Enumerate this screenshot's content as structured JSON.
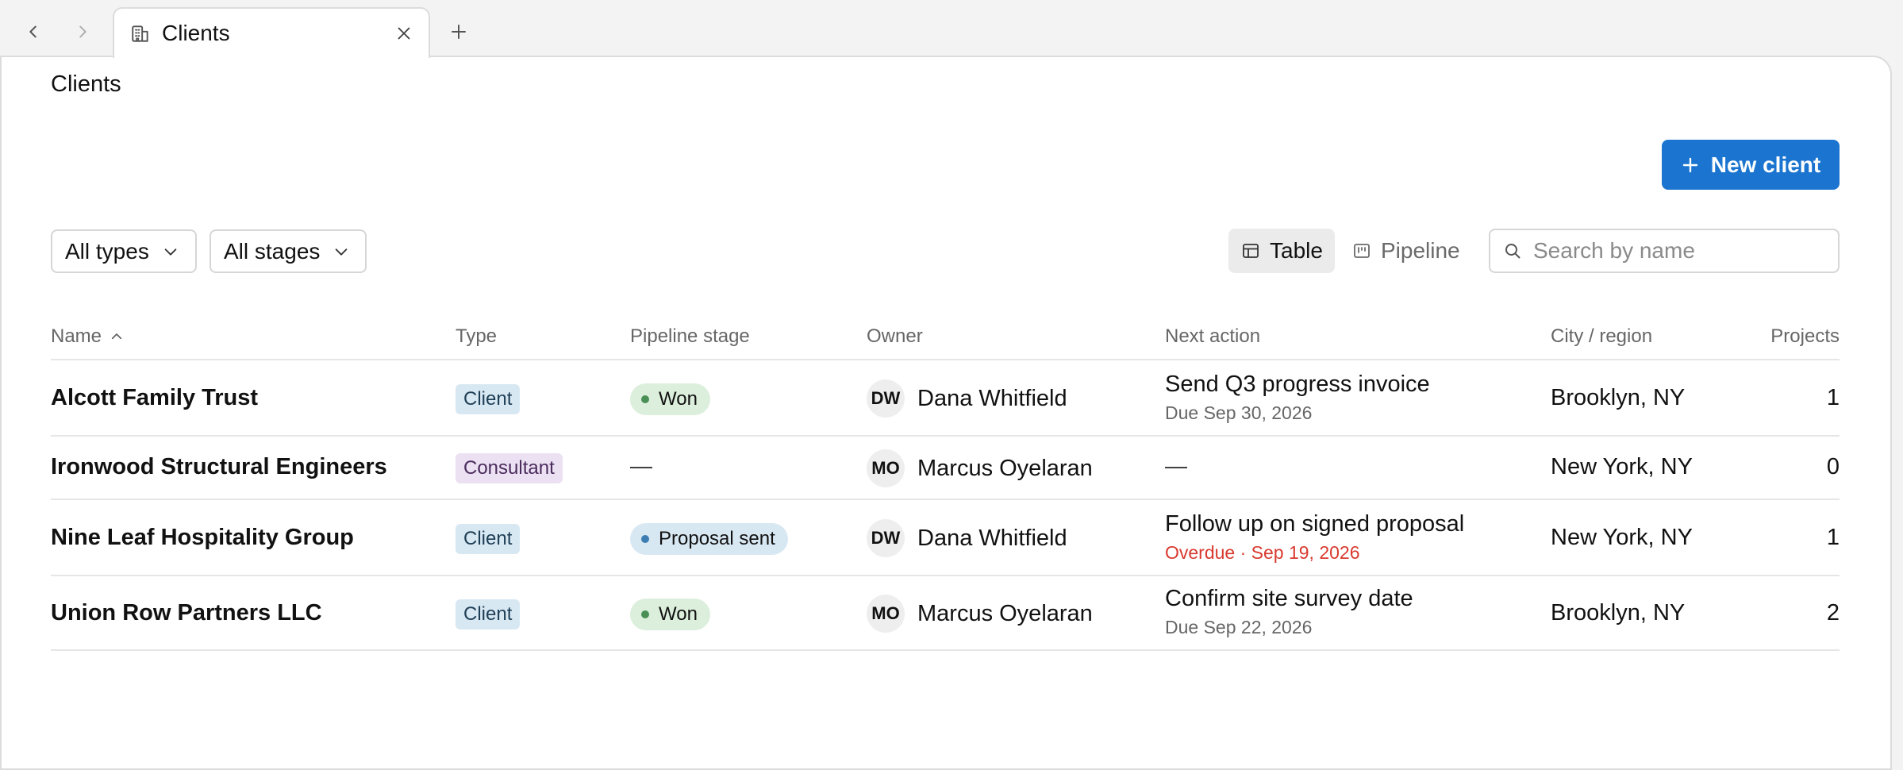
{
  "tabs": {
    "active_title": "Clients"
  },
  "page": {
    "breadcrumb": "Clients",
    "new_client_label": "New client"
  },
  "filters": {
    "types_value": "All types",
    "stages_value": "All stages"
  },
  "view_toggle": {
    "table_label": "Table",
    "pipeline_label": "Pipeline",
    "selected": "Table"
  },
  "search": {
    "placeholder": "Search by name",
    "value": ""
  },
  "table": {
    "columns": {
      "name": "Name",
      "type": "Type",
      "stage": "Pipeline stage",
      "owner": "Owner",
      "next": "Next action",
      "city": "City / region",
      "projects": "Projects"
    },
    "sort": {
      "column": "Name",
      "direction": "ascending"
    },
    "rows": [
      {
        "name": "Alcott Family Trust",
        "type": "Client",
        "stage": "Won",
        "owner_initials": "DW",
        "owner_name": "Dana Whitfield",
        "next_title": "Send Q3 progress invoice",
        "next_sub": "Due Sep 30, 2026",
        "city": "Brooklyn, NY",
        "projects": "1"
      },
      {
        "name": "Ironwood Structural Engineers",
        "type": "Consultant",
        "stage": "—",
        "owner_initials": "MO",
        "owner_name": "Marcus Oyelaran",
        "next_title": "—",
        "next_sub": "",
        "city": "New York, NY",
        "projects": "0"
      },
      {
        "name": "Nine Leaf Hospitality Group",
        "type": "Client",
        "stage": "Proposal sent",
        "owner_initials": "DW",
        "owner_name": "Dana Whitfield",
        "next_title": "Follow up on signed proposal",
        "next_sub": "Overdue · Sep 19, 2026",
        "city": "New York, NY",
        "projects": "1"
      },
      {
        "name": "Union Row Partners LLC",
        "type": "Client",
        "stage": "Won",
        "owner_initials": "MO",
        "owner_name": "Marcus Oyelaran",
        "next_title": "Confirm site survey date",
        "next_sub": "Due Sep 22, 2026",
        "city": "Brooklyn, NY",
        "projects": "2"
      }
    ]
  },
  "colors": {
    "accent": "#1b75d0",
    "overdue": "#d93a2f",
    "won_bg": "#dcefdc",
    "proposal_bg": "#d8e8f3",
    "consultant_bg": "#ece1f3"
  },
  "icons": {
    "back": "chevron-left-icon",
    "forward": "chevron-right-icon",
    "tab": "building-icon",
    "close": "close-icon",
    "new_tab": "plus-icon",
    "table_view": "table-icon",
    "pipeline_view": "kanban-icon",
    "search": "search-icon",
    "sort": "chevron-up-icon",
    "dropdown": "chevron-down-icon"
  }
}
